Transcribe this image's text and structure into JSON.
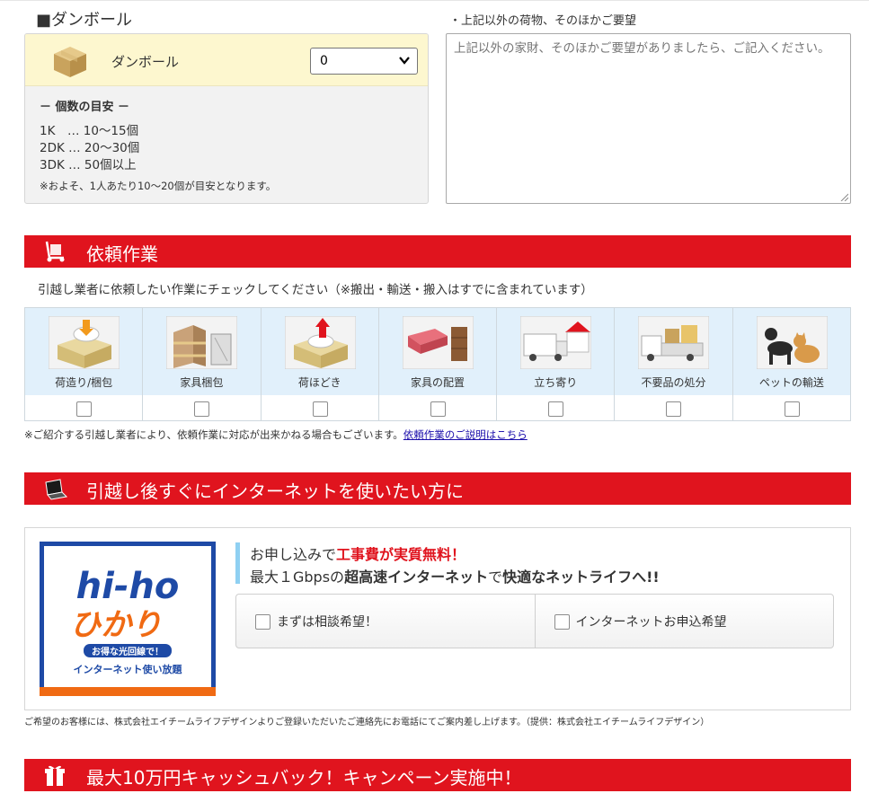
{
  "box_section": {
    "heading": "■ダンボール",
    "label": "ダンボール",
    "selected_value": "0",
    "guide_title": "－ 個数の目安 －",
    "guide_lines": [
      "1K　… 10～15個",
      "2DK … 20～30個",
      "3DK … 50個以上"
    ],
    "guide_note": "※およそ、1人あたり10～20個が目安となります。"
  },
  "other_items": {
    "label": "・上記以外の荷物、そのほかご要望",
    "placeholder": "上記以外の家財、そのほかご要望がありましたら、ご記入ください。"
  },
  "tasks": {
    "title": "依頼作業",
    "intro": "引越し業者に依頼したい作業にチェックしてください（※搬出・輸送・搬入はすでに含まれています）",
    "items": [
      {
        "label": "荷造り/梱包"
      },
      {
        "label": "家具梱包"
      },
      {
        "label": "荷ほどき"
      },
      {
        "label": "家具の配置"
      },
      {
        "label": "立ち寄り"
      },
      {
        "label": "不要品の処分"
      },
      {
        "label": "ペットの輸送"
      }
    ],
    "note": "※ご紹介する引越し業者により、依頼作業に対応が出来かねる場合もございます。",
    "note_link": "依頼作業のご説明はこちら"
  },
  "internet": {
    "title": "引越し後すぐにインターネットを使いたい方に",
    "logo_line1": "hi-ho",
    "logo_line2": "ひかり",
    "logo_badge": "お得な光回線で！",
    "logo_tagline": "インターネット使い放題",
    "promo_prefix": "お申し込みで",
    "promo_highlight": "工事費が実質無料！",
    "promo2_a": "最大１Gbpsの",
    "promo2_b": "超高速インターネット",
    "promo2_c": "で",
    "promo2_d": "快適なネットライフへ!!",
    "option1": "まずは相談希望！",
    "option2": "インターネットお申込希望",
    "note": "ご希望のお客様には、株式会社エイチームライフデザインよりご登録いただいたご連絡先にお電話にてご案内差し上げます。（提供：株式会社エイチームライフデザイン）"
  },
  "campaign": {
    "title": "最大10万円キャッシュバック！キャンペーン実施中！"
  },
  "colors": {
    "red": "#e0141e",
    "light_blue": "#e1f0fb",
    "cream": "#fdf7cf",
    "hiho_blue": "#1e4aa6",
    "hiho_orange": "#f06a13"
  }
}
